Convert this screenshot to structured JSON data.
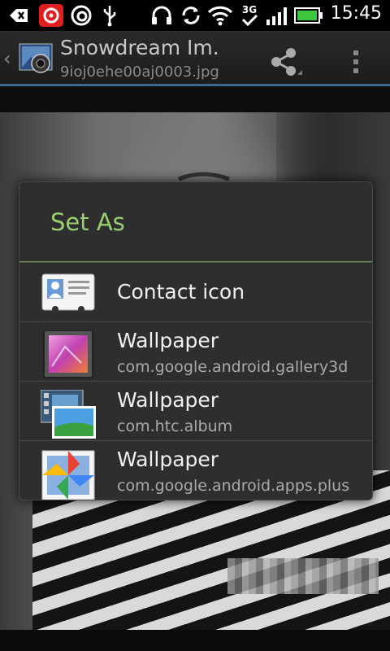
{
  "status_bar": {
    "time": "15:45",
    "network_type": "3G",
    "icons": [
      "back-notification-icon",
      "netease-music-icon",
      "beats-icon",
      "usb-icon",
      "headphones-icon",
      "sync-icon",
      "wifi-icon",
      "signal-icon",
      "battery-icon"
    ],
    "battery_color": "#3ec63e"
  },
  "action_bar": {
    "title": "Snowdream Im.",
    "subtitle": "9ioj0ehe00aj0003.jpg",
    "accent_color": "#3a6a8a"
  },
  "dialog": {
    "title": "Set As",
    "title_color": "#9bcf70",
    "options": [
      {
        "label": "Contact icon",
        "package": "",
        "icon": "contact-card-icon"
      },
      {
        "label": "Wallpaper",
        "package": "com.google.android.gallery3d",
        "icon": "gallery-frame-icon"
      },
      {
        "label": "Wallpaper",
        "package": "com.htc.album",
        "icon": "htc-album-icon"
      },
      {
        "label": "Wallpaper",
        "package": "com.google.android.apps.plus",
        "icon": "google-photos-pinwheel-icon"
      }
    ]
  }
}
